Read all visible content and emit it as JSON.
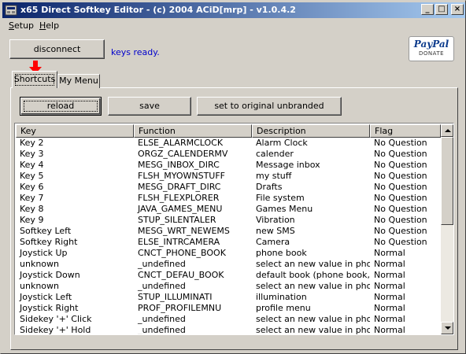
{
  "window": {
    "title": "x65 Direct Softkey Editor - (c) 2004 ACiD[mrp] - v1.0.4.2",
    "minimize_glyph": "_",
    "maximize_glyph": "□",
    "close_glyph": "×"
  },
  "menu": [
    {
      "accel": "S",
      "rest": "etup"
    },
    {
      "accel": "H",
      "rest": "elp"
    }
  ],
  "toolbar": {
    "disconnect_label": "disconnect",
    "status_text": "keys ready."
  },
  "paypal": {
    "brand": "PayPal",
    "donate": "DONATE"
  },
  "tabs": [
    {
      "label": "Shortcuts",
      "active": true
    },
    {
      "label": "My Menu",
      "active": false
    }
  ],
  "actions": {
    "reload_label": "reload",
    "save_label": "save",
    "reset_label": "set to original unbranded"
  },
  "table": {
    "columns": [
      "Key",
      "Function",
      "Description",
      "Flag"
    ],
    "rows": [
      [
        "Key 2",
        "ELSE_ALARMCLOCK",
        "Alarm Clock",
        "No Question"
      ],
      [
        "Key 3",
        "ORGZ_CALENDERMV",
        "calender",
        "No Question"
      ],
      [
        "Key 4",
        "MESG_INBOX_DIRC",
        "Message inbox",
        "No Question"
      ],
      [
        "Key 5",
        "FLSH_MYOWNSTUFF",
        "my stuff",
        "No Question"
      ],
      [
        "Key 6",
        "MESG_DRAFT_DIRC",
        "Drafts",
        "No Question"
      ],
      [
        "Key 7",
        "FLSH_FLEXPLORER",
        "File system",
        "No Question"
      ],
      [
        "Key 8",
        "JAVA_GAMES_MENU",
        "Games Menu",
        "No Question"
      ],
      [
        "Key 9",
        "STUP_SILENTALER",
        "Vibration",
        "No Question"
      ],
      [
        "Softkey Left",
        "MESG_WRT_NEWEMS",
        "new SMS",
        "No Question"
      ],
      [
        "Softkey Right",
        "ELSE_INTRCAMERA",
        "Camera",
        "No Question"
      ],
      [
        "Joystick Up",
        "CNCT_PHONE_BOOK",
        "phone book",
        "Normal"
      ],
      [
        "unknown",
        "_undefined",
        "select an new value in pho...",
        "Normal"
      ],
      [
        "Joystick Down",
        "CNCT_DEFAU_BOOK",
        "default book (phone book, ...",
        "Normal"
      ],
      [
        "unknown",
        "_undefined",
        "select an new value in pho...",
        "Normal"
      ],
      [
        "Joystick Left",
        "STUP_ILLUMINATI",
        "illumination",
        "Normal"
      ],
      [
        "Joystick Right",
        "PROF_PROFILEMNU",
        "profile menu",
        "Normal"
      ],
      [
        "Sidekey '+' Click",
        "_undefined",
        "select an new value in pho...",
        "Normal"
      ],
      [
        "Sidekey '+' Hold",
        "_undefined",
        "select an new value in pho...",
        "Normal"
      ]
    ]
  },
  "colors": {
    "title_gradient_start": "#0a246a",
    "title_gradient_end": "#a6caf0",
    "status_text": "#0000cc",
    "arrow": "#ff0000",
    "paypal_brand": "#0c3b8c"
  },
  "icons": {
    "app": "app-icon",
    "arrow": "red-down-arrow-icon",
    "scroll_up": "scroll-up-icon",
    "scroll_down": "scroll-down-icon"
  }
}
